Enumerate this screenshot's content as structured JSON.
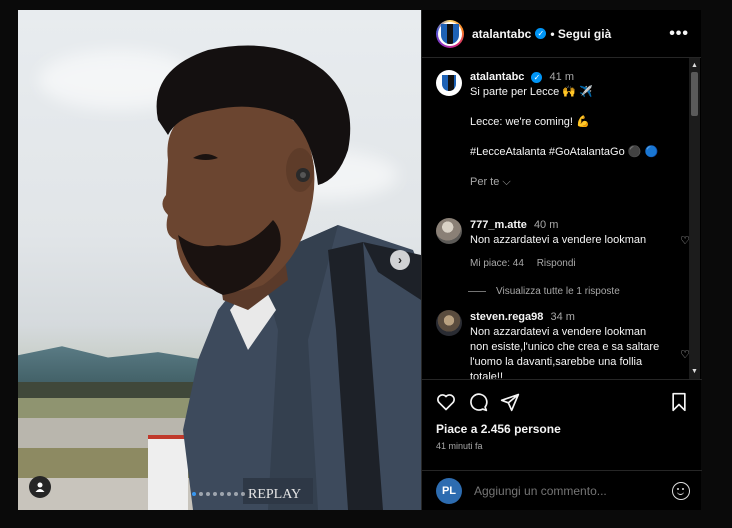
{
  "post": {
    "author": "atalantabc",
    "follow_label": "• Segui già",
    "more_label": "•••",
    "photo_dots": 8,
    "active_dot": 0
  },
  "caption": {
    "username": "atalantabc",
    "time": "41 m",
    "line1": "Si parte per Lecce 🙌 ✈️",
    "line2": "Lecce: we're coming! 💪",
    "line3": "#LecceAtalanta #GoAtalantaGo ⚫ 🔵",
    "translation_link": "Per te ⌵"
  },
  "comments": [
    {
      "username": "777_m.atte",
      "time": "40 m",
      "text": "Non azzardatevi a vendere lookman",
      "likes_label": "Mi piace: 44",
      "reply_label": "Rispondi",
      "view_replies": "Visualizza tutte le 1 risposte"
    },
    {
      "username": "steven.rega98",
      "time": "34 m",
      "text": "Non azzardatevi a vendere lookman non esiste,l'unico che crea e sa saltare l'uomo la davanti,sarebbe una follia totale!!"
    }
  ],
  "stats": {
    "likes": "Piace a 2.456 persone",
    "posted": "41 minuti fa"
  },
  "composer": {
    "avatar_initials": "PL",
    "placeholder": "Aggiungi un commento..."
  },
  "photo": {
    "jacket_brand": "REPLAY"
  }
}
